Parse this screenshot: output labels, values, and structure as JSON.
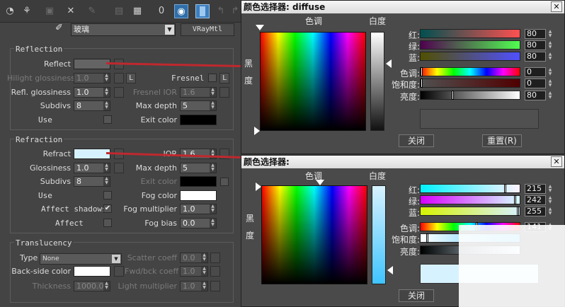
{
  "toolbar": {
    "icons": [
      "get-material-icon",
      "assign-icon",
      "reset-icon",
      "delete-icon",
      "make-unique-icon",
      "put-library-icon",
      "material-id-icon",
      "show-map-icon",
      "show-end-result-icon",
      "go-parent-icon",
      "go-sibling-icon"
    ],
    "delete_glyph": "✕",
    "material_id_label": "0"
  },
  "material": {
    "name": "玻璃",
    "type": "VRayMtl"
  },
  "reflection": {
    "title": "Reflection",
    "reflect_label": "Reflect",
    "reflect_color": "#646464",
    "hilight_label": "Hilight glossiness",
    "hilight_value": "1.0",
    "lock_label": "L",
    "fresnel_label": "Fresnel",
    "fresnel_l": "L",
    "refl_gloss_label": "Refl. glossiness",
    "refl_gloss_value": "1.0",
    "fresnel_ior_label": "Fresnel IOR",
    "fresnel_ior_value": "1.6",
    "subdivs_label": "Subdivs",
    "subdivs_value": "8",
    "max_depth_label": "Max depth",
    "max_depth_value": "5",
    "use_label": "Use",
    "exit_color_label": "Exit color",
    "exit_color": "#000000"
  },
  "refraction": {
    "title": "Refraction",
    "refract_label": "Refract",
    "refract_color": "#d7f2ff",
    "ior_label": "IOR",
    "ior_value": "1.6",
    "glossiness_label": "Glossiness",
    "glossiness_value": "1.0",
    "max_depth_label": "Max depth",
    "max_depth_value": "5",
    "subdivs_label": "Subdivs",
    "subdivs_value": "8",
    "exit_color_label": "Exit color",
    "exit_color": "#000000",
    "use_label": "Use",
    "fog_color_label": "Fog color",
    "fog_color": "#ffffff",
    "affect_shadows_label": "Affect shadows",
    "affect_shadows_check": "✔",
    "fog_multiplier_label": "Fog multiplier",
    "fog_multiplier_value": "1.0",
    "affect_label": "Affect",
    "fog_bias_label": "Fog bias",
    "fog_bias_value": "0.0"
  },
  "translucency": {
    "title": "Translucency",
    "type_label": "Type",
    "type_value": "None",
    "scatter_label": "Scatter coeff",
    "scatter_value": "0.0",
    "backside_label": "Back-side color",
    "backside_color": "#ffffff",
    "fwd_label": "Fwd/bck coeff",
    "fwd_value": "1.0",
    "thickness_label": "Thickness",
    "thickness_value": "1000.0",
    "light_mult_label": "Light multiplier",
    "light_mult_value": "1.0"
  },
  "picker1": {
    "title": "颜色选择器: diffuse",
    "close_glyph": "✕",
    "hue_label": "色调",
    "whiteness_label": "白度",
    "black_label_1": "黑",
    "black_label_2": "度",
    "red_label": "红:",
    "red_value": "80",
    "green_label": "绿:",
    "green_value": "80",
    "blue_label": "蓝:",
    "blue_value": "80",
    "hue_row_label": "色调:",
    "hue_value": "0",
    "sat_label": "饱和度:",
    "sat_value": "0",
    "bright_label": "亮度:",
    "bright_value": "80",
    "preview_color": "#505050",
    "close_button": "关闭",
    "reset_button": "重置(R)"
  },
  "picker2": {
    "title": "颜色选择器:",
    "close_glyph": "✕",
    "hue_label": "色调",
    "whiteness_label": "白度",
    "black_label_1": "黑",
    "black_label_2": "度",
    "red_label": "红:",
    "red_value": "215",
    "green_label": "绿:",
    "green_value": "242",
    "blue_label": "蓝:",
    "blue_value": "255",
    "hue_row_label": "色调:",
    "hue_value": "141",
    "sat_label": "饱和度:",
    "bright_label": "亮度:",
    "preview_color": "#d7f2ff",
    "close_button": "关闭"
  }
}
